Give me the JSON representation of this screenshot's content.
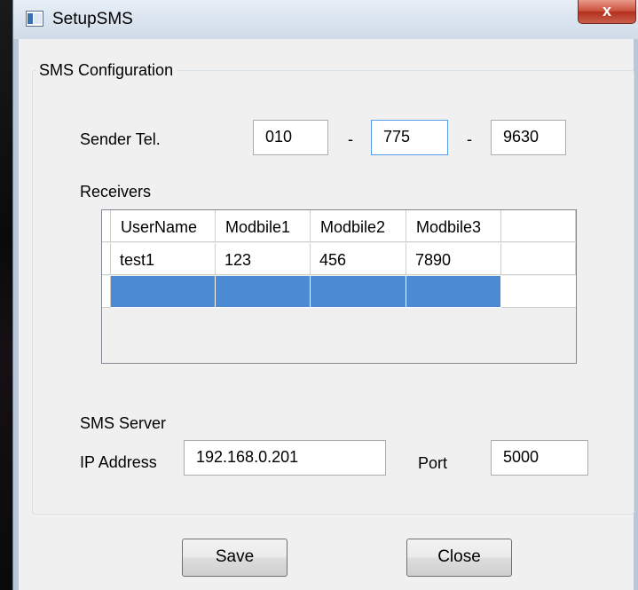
{
  "window": {
    "title": "SetupSMS",
    "close_glyph": "x"
  },
  "group": {
    "title": "SMS Configuration"
  },
  "sender": {
    "label": "Sender Tel.",
    "part1": "010",
    "sep1": "-",
    "part2": "775",
    "sep2": "-",
    "part3": "9630"
  },
  "receivers": {
    "label": "Receivers",
    "columns": [
      "UserName",
      "Modbile1",
      "Modbile2",
      "Modbile3"
    ],
    "rows": [
      [
        "test1",
        "123",
        "456",
        "7890"
      ]
    ]
  },
  "server": {
    "label": "SMS Server",
    "ip_label": "IP Address",
    "ip_value": "192.168.0.201",
    "port_label": "Port",
    "port_value": "5000"
  },
  "buttons": {
    "save": "Save",
    "close": "Close"
  }
}
